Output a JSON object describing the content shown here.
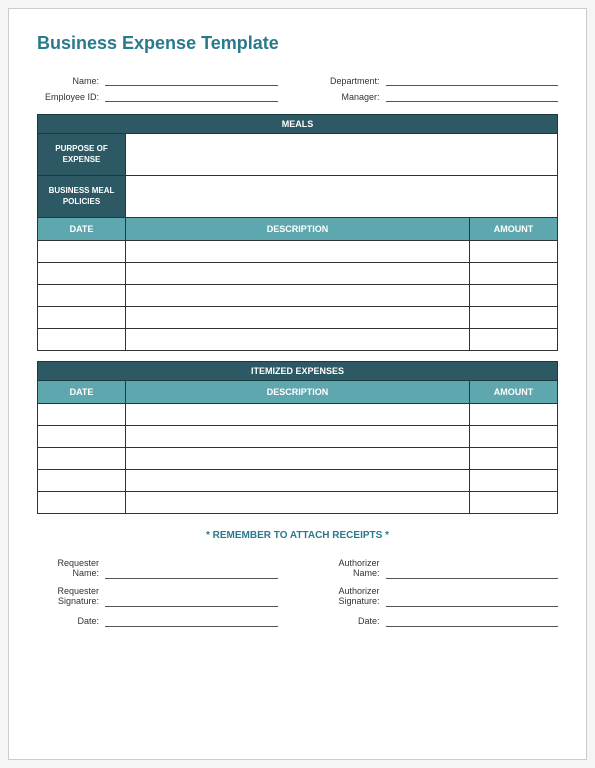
{
  "title": "Business Expense Template",
  "header": {
    "name_label": "Name:",
    "employee_id_label": "Employee ID:",
    "department_label": "Department:",
    "manager_label": "Manager:"
  },
  "meals": {
    "section_title": "MEALS",
    "purpose_label": "PURPOSE OF EXPENSE",
    "policies_label": "BUSINESS MEAL POLICIES",
    "columns": {
      "date": "DATE",
      "description": "DESCRIPTION",
      "amount": "AMOUNT"
    },
    "rows": [
      "",
      "",
      "",
      "",
      ""
    ]
  },
  "itemized": {
    "section_title": "ITEMIZED EXPENSES",
    "columns": {
      "date": "DATE",
      "description": "DESCRIPTION",
      "amount": "AMOUNT"
    },
    "rows": [
      "",
      "",
      "",
      "",
      ""
    ]
  },
  "reminder": "* REMEMBER TO ATTACH RECEIPTS *",
  "signatures": {
    "requester_name": "Requester Name:",
    "requester_signature": "Requester Signature:",
    "requester_date": "Date:",
    "authorizer_name": "Authorizer Name:",
    "authorizer_signature": "Authorizer Signature:",
    "authorizer_date": "Date:"
  }
}
